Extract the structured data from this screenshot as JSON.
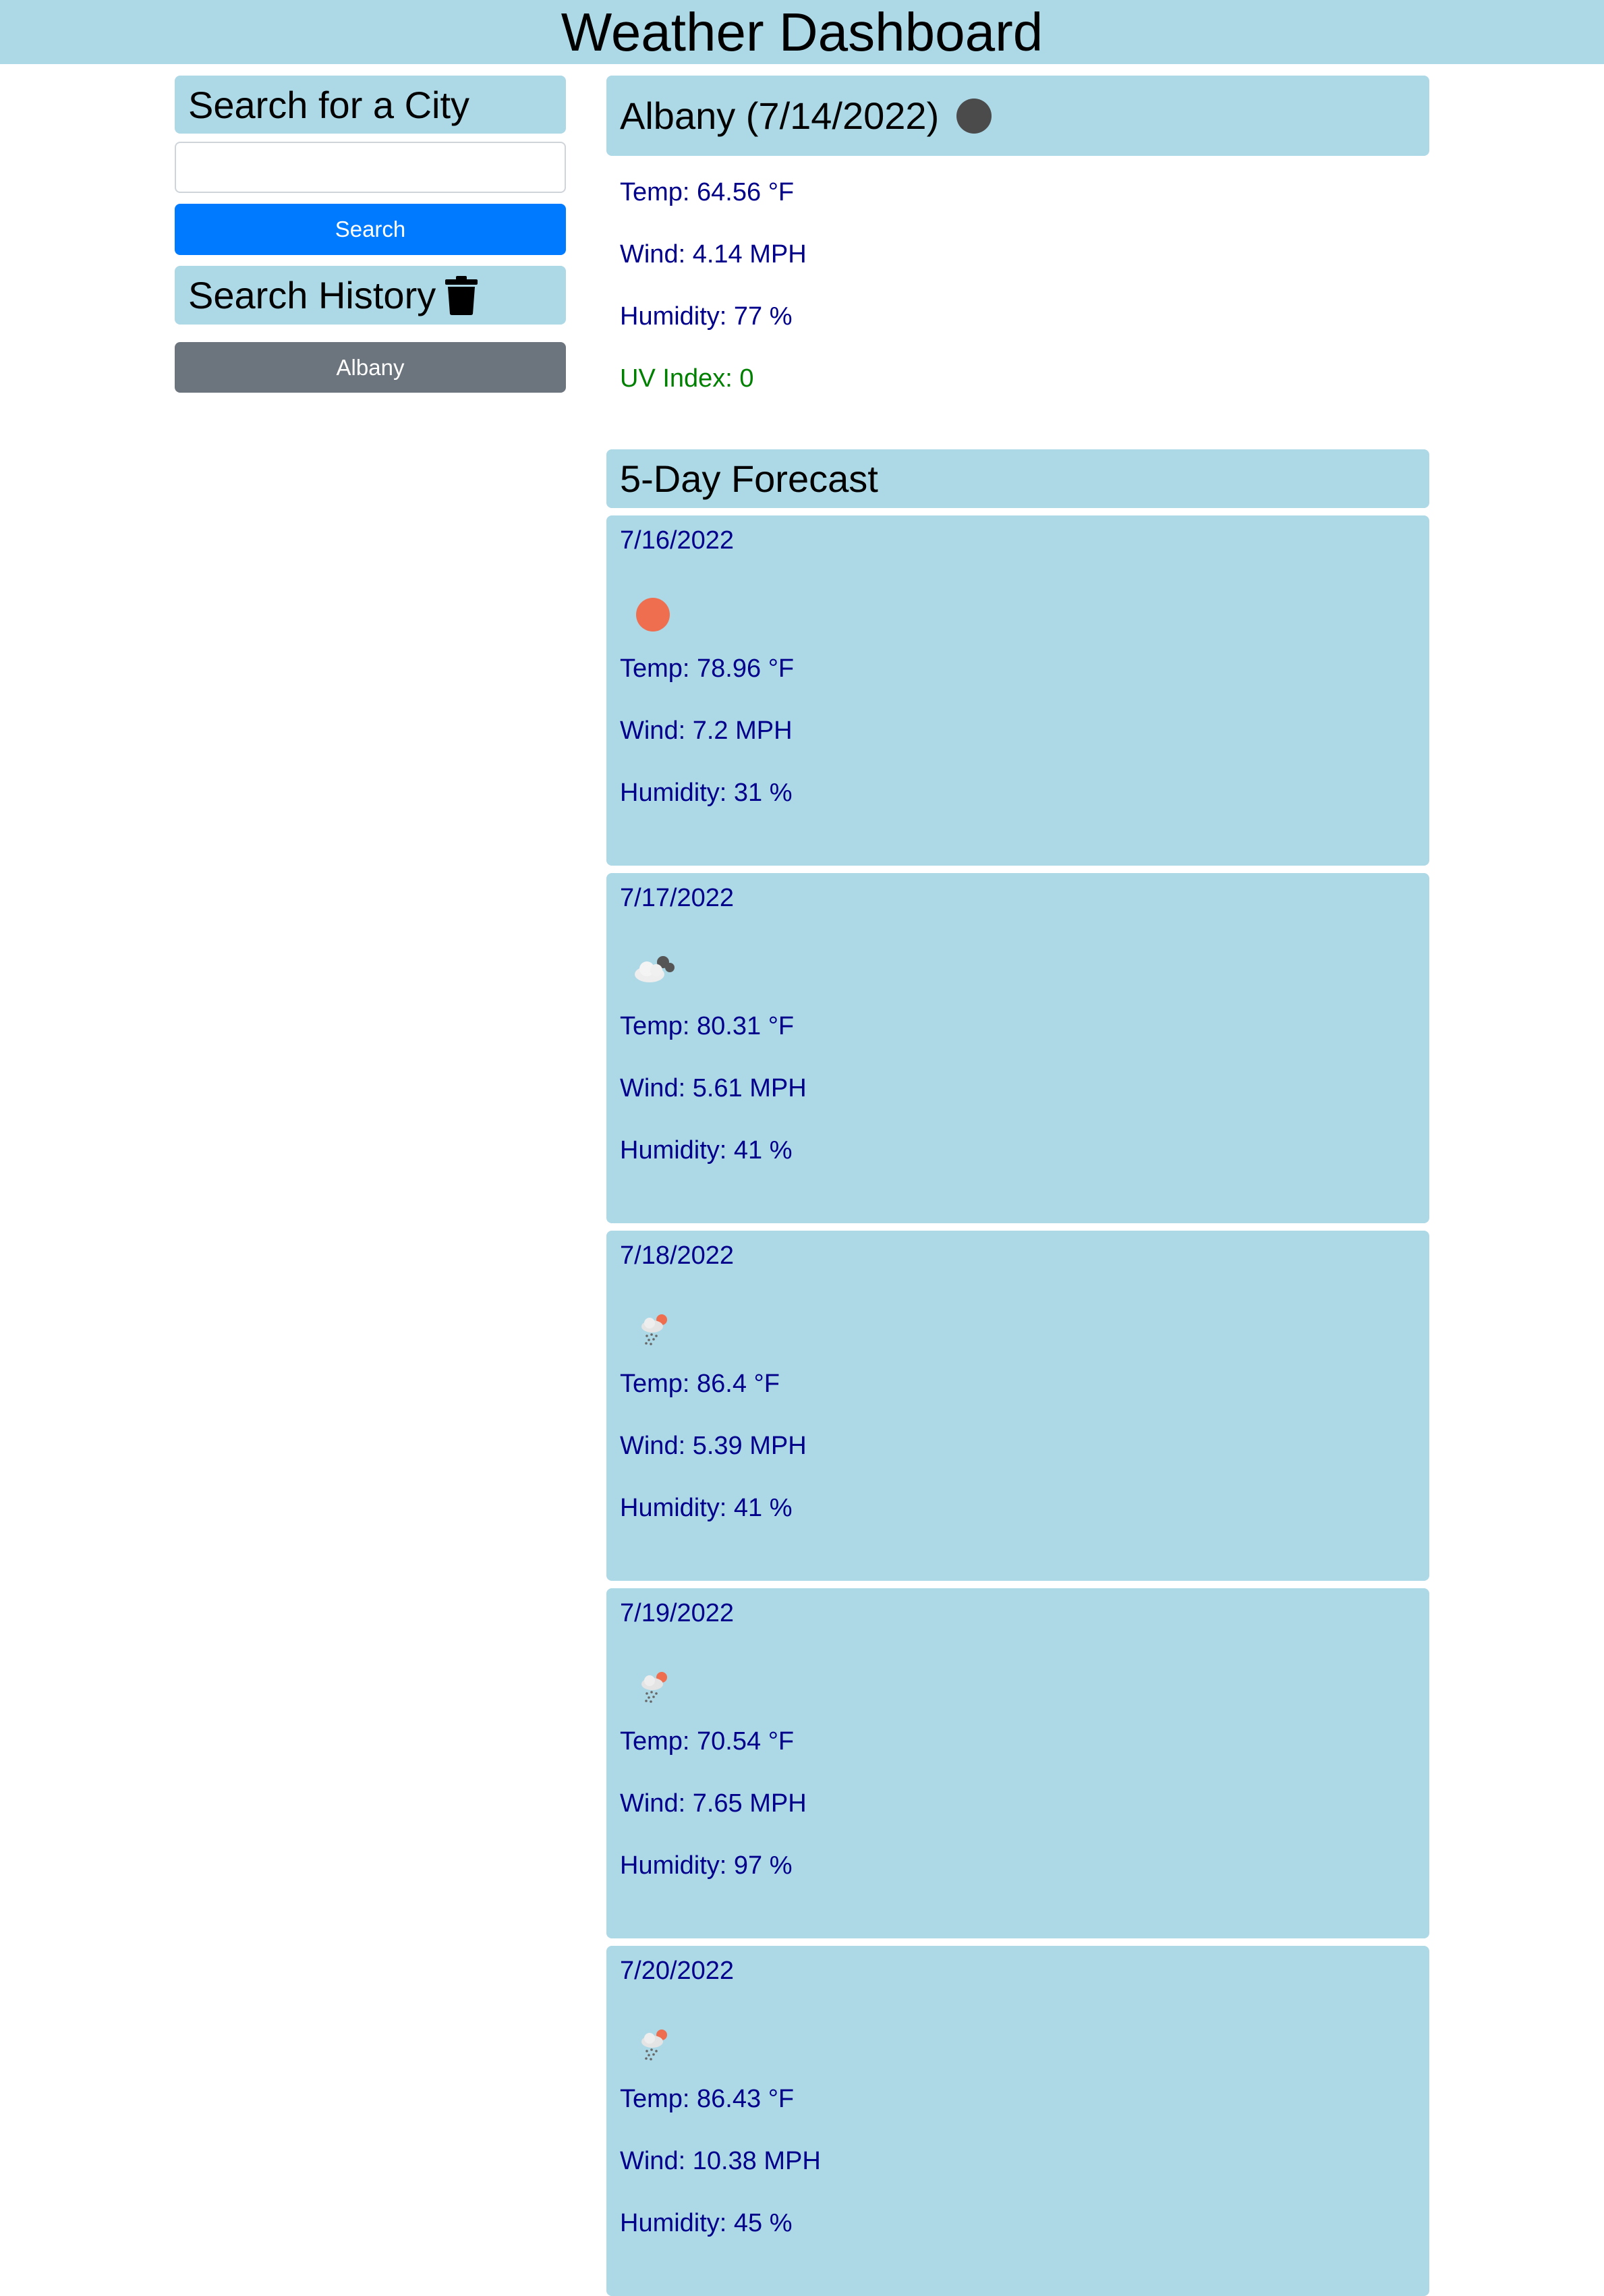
{
  "header": {
    "title": "Weather Dashboard"
  },
  "sidebar": {
    "search_title": "Search for a City",
    "search_placeholder": "",
    "search_button": "Search",
    "history_title": "Search History",
    "history_items": [
      "Albany"
    ]
  },
  "current": {
    "title": "Albany (7/14/2022)",
    "icon": "moon-icon",
    "temp": "Temp: 64.56 °F",
    "wind": "Wind: 4.14 MPH",
    "humidity": "Humidity: 77 %",
    "uv": "UV Index: 0",
    "uv_color": "#008000"
  },
  "forecast": {
    "title": "5-Day Forecast",
    "days": [
      {
        "date": "7/16/2022",
        "icon": "sun-icon",
        "temp": "Temp: 78.96 °F",
        "wind": "Wind: 7.2 MPH",
        "humidity": "Humidity: 31 %"
      },
      {
        "date": "7/17/2022",
        "icon": "cloud-icon",
        "temp": "Temp: 80.31 °F",
        "wind": "Wind: 5.61 MPH",
        "humidity": "Humidity: 41 %"
      },
      {
        "date": "7/18/2022",
        "icon": "rain-icon",
        "temp": "Temp: 86.4 °F",
        "wind": "Wind: 5.39 MPH",
        "humidity": "Humidity: 41 %"
      },
      {
        "date": "7/19/2022",
        "icon": "rain-icon",
        "temp": "Temp: 70.54 °F",
        "wind": "Wind: 7.65 MPH",
        "humidity": "Humidity: 97 %"
      },
      {
        "date": "7/20/2022",
        "icon": "rain-icon",
        "temp": "Temp: 86.43 °F",
        "wind": "Wind: 10.38 MPH",
        "humidity": "Humidity: 45 %"
      }
    ]
  },
  "colors": {
    "panel": "#add8e6",
    "primary": "#007bff",
    "secondary": "#6c757d",
    "text_stat": "#00008b"
  }
}
